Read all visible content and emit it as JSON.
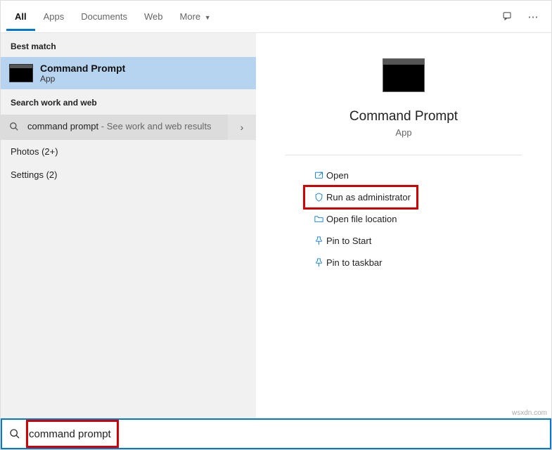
{
  "tabs": {
    "all": "All",
    "apps": "Apps",
    "documents": "Documents",
    "web": "Web",
    "more": "More"
  },
  "sections": {
    "best_match": "Best match",
    "search_web": "Search work and web"
  },
  "best_match": {
    "title": "Command Prompt",
    "subtitle": "App"
  },
  "web_result": {
    "query": "command prompt",
    "suffix": " - See work and web results"
  },
  "categories": {
    "photos": "Photos (2+)",
    "settings": "Settings (2)"
  },
  "preview": {
    "title": "Command Prompt",
    "subtitle": "App"
  },
  "actions": {
    "open": "Open",
    "run_admin": "Run as administrator",
    "open_location": "Open file location",
    "pin_start": "Pin to Start",
    "pin_taskbar": "Pin to taskbar"
  },
  "search": {
    "value": "command prompt"
  },
  "watermark": "wsxdn.com"
}
